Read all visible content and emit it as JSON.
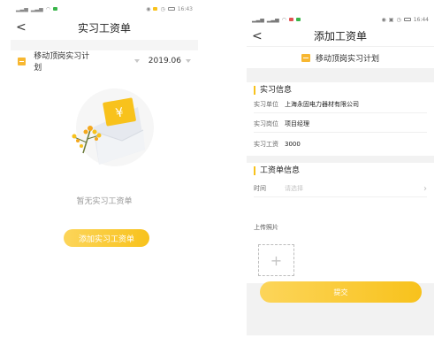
{
  "colors": {
    "accent": "#f8c21c",
    "accent_light": "#fcd55a",
    "text_primary": "#222222",
    "text_secondary": "#999999",
    "page_bg": "#f5f5f5"
  },
  "screen1": {
    "status_bar": {
      "left_icons": "signal-wifi-icons",
      "time": "16:43"
    },
    "header": {
      "back_icon": "chevron-left-icon",
      "title": "实习工资单"
    },
    "filter": {
      "plan_icon": "document-icon",
      "plan_name": "移动顶岗实习计划",
      "period": "2019.06"
    },
    "empty_state": {
      "illustration": "envelope-with-yen-card-illustration",
      "message": "暂无实习工资单",
      "add_button_label": "添加实习工资单"
    }
  },
  "screen2": {
    "status_bar": {
      "left_icons": "signal-wifi-icons",
      "time": "16:44"
    },
    "header": {
      "back_icon": "chevron-left-icon",
      "title": "添加工资单"
    },
    "plan": {
      "plan_icon": "document-icon",
      "plan_name": "移动顶岗实习计划"
    },
    "internship_info": {
      "section_title": "实习信息",
      "rows": [
        {
          "label": "实习单位",
          "value": "上海永固电力器材有限公司"
        },
        {
          "label": "实习岗位",
          "value": "项目经理"
        },
        {
          "label": "实习工资",
          "value": "3000"
        }
      ]
    },
    "payslip_info": {
      "section_title": "工资单信息",
      "time_label": "时间",
      "time_placeholder": "请选择",
      "upload_label": "上传照片",
      "upload_icon": "plus-icon"
    },
    "submit_label": "提交"
  }
}
